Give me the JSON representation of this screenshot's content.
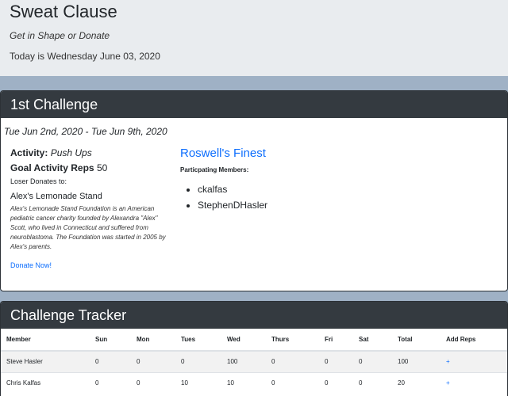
{
  "app": {
    "title": "Sweat Clause",
    "tagline": "Get in Shape or Donate",
    "today": "Today is Wednesday June 03, 2020"
  },
  "challenge": {
    "header": "1st Challenge",
    "dates": "Tue Jun 2nd, 2020 - Tue Jun 9th, 2020",
    "activity_label": "Activity:",
    "activity_value": "Push Ups",
    "goal_label": "Goal Activity Reps",
    "goal_value": "50",
    "loser_label": "Loser Donates to:",
    "charity_name": "Alex's Lemonade Stand",
    "charity_desc": "Alex's Lemonade Stand Foundation is an American pediatric cancer charity founded by Alexandra \"Alex\" Scott, who lived in Connecticut and suffered from neuroblastoma. The Foundation was started in 2005 by Alex's parents.",
    "donate_label": "Donate Now!",
    "team_name": "Roswell's Finest",
    "members_label": "Particpating Members:",
    "members": [
      "ckalfas",
      "StephenDHasler"
    ]
  },
  "tracker": {
    "header": "Challenge Tracker",
    "columns": [
      "Member",
      "Sun",
      "Mon",
      "Tues",
      "Wed",
      "Thurs",
      "Fri",
      "Sat",
      "Total",
      "Add Reps"
    ],
    "rows": [
      [
        "Steve Hasler",
        "0",
        "0",
        "0",
        "100",
        "0",
        "0",
        "0",
        "100",
        "+"
      ],
      [
        "Chris Kalfas",
        "0",
        "0",
        "10",
        "10",
        "0",
        "0",
        "0",
        "20",
        "+"
      ]
    ]
  }
}
